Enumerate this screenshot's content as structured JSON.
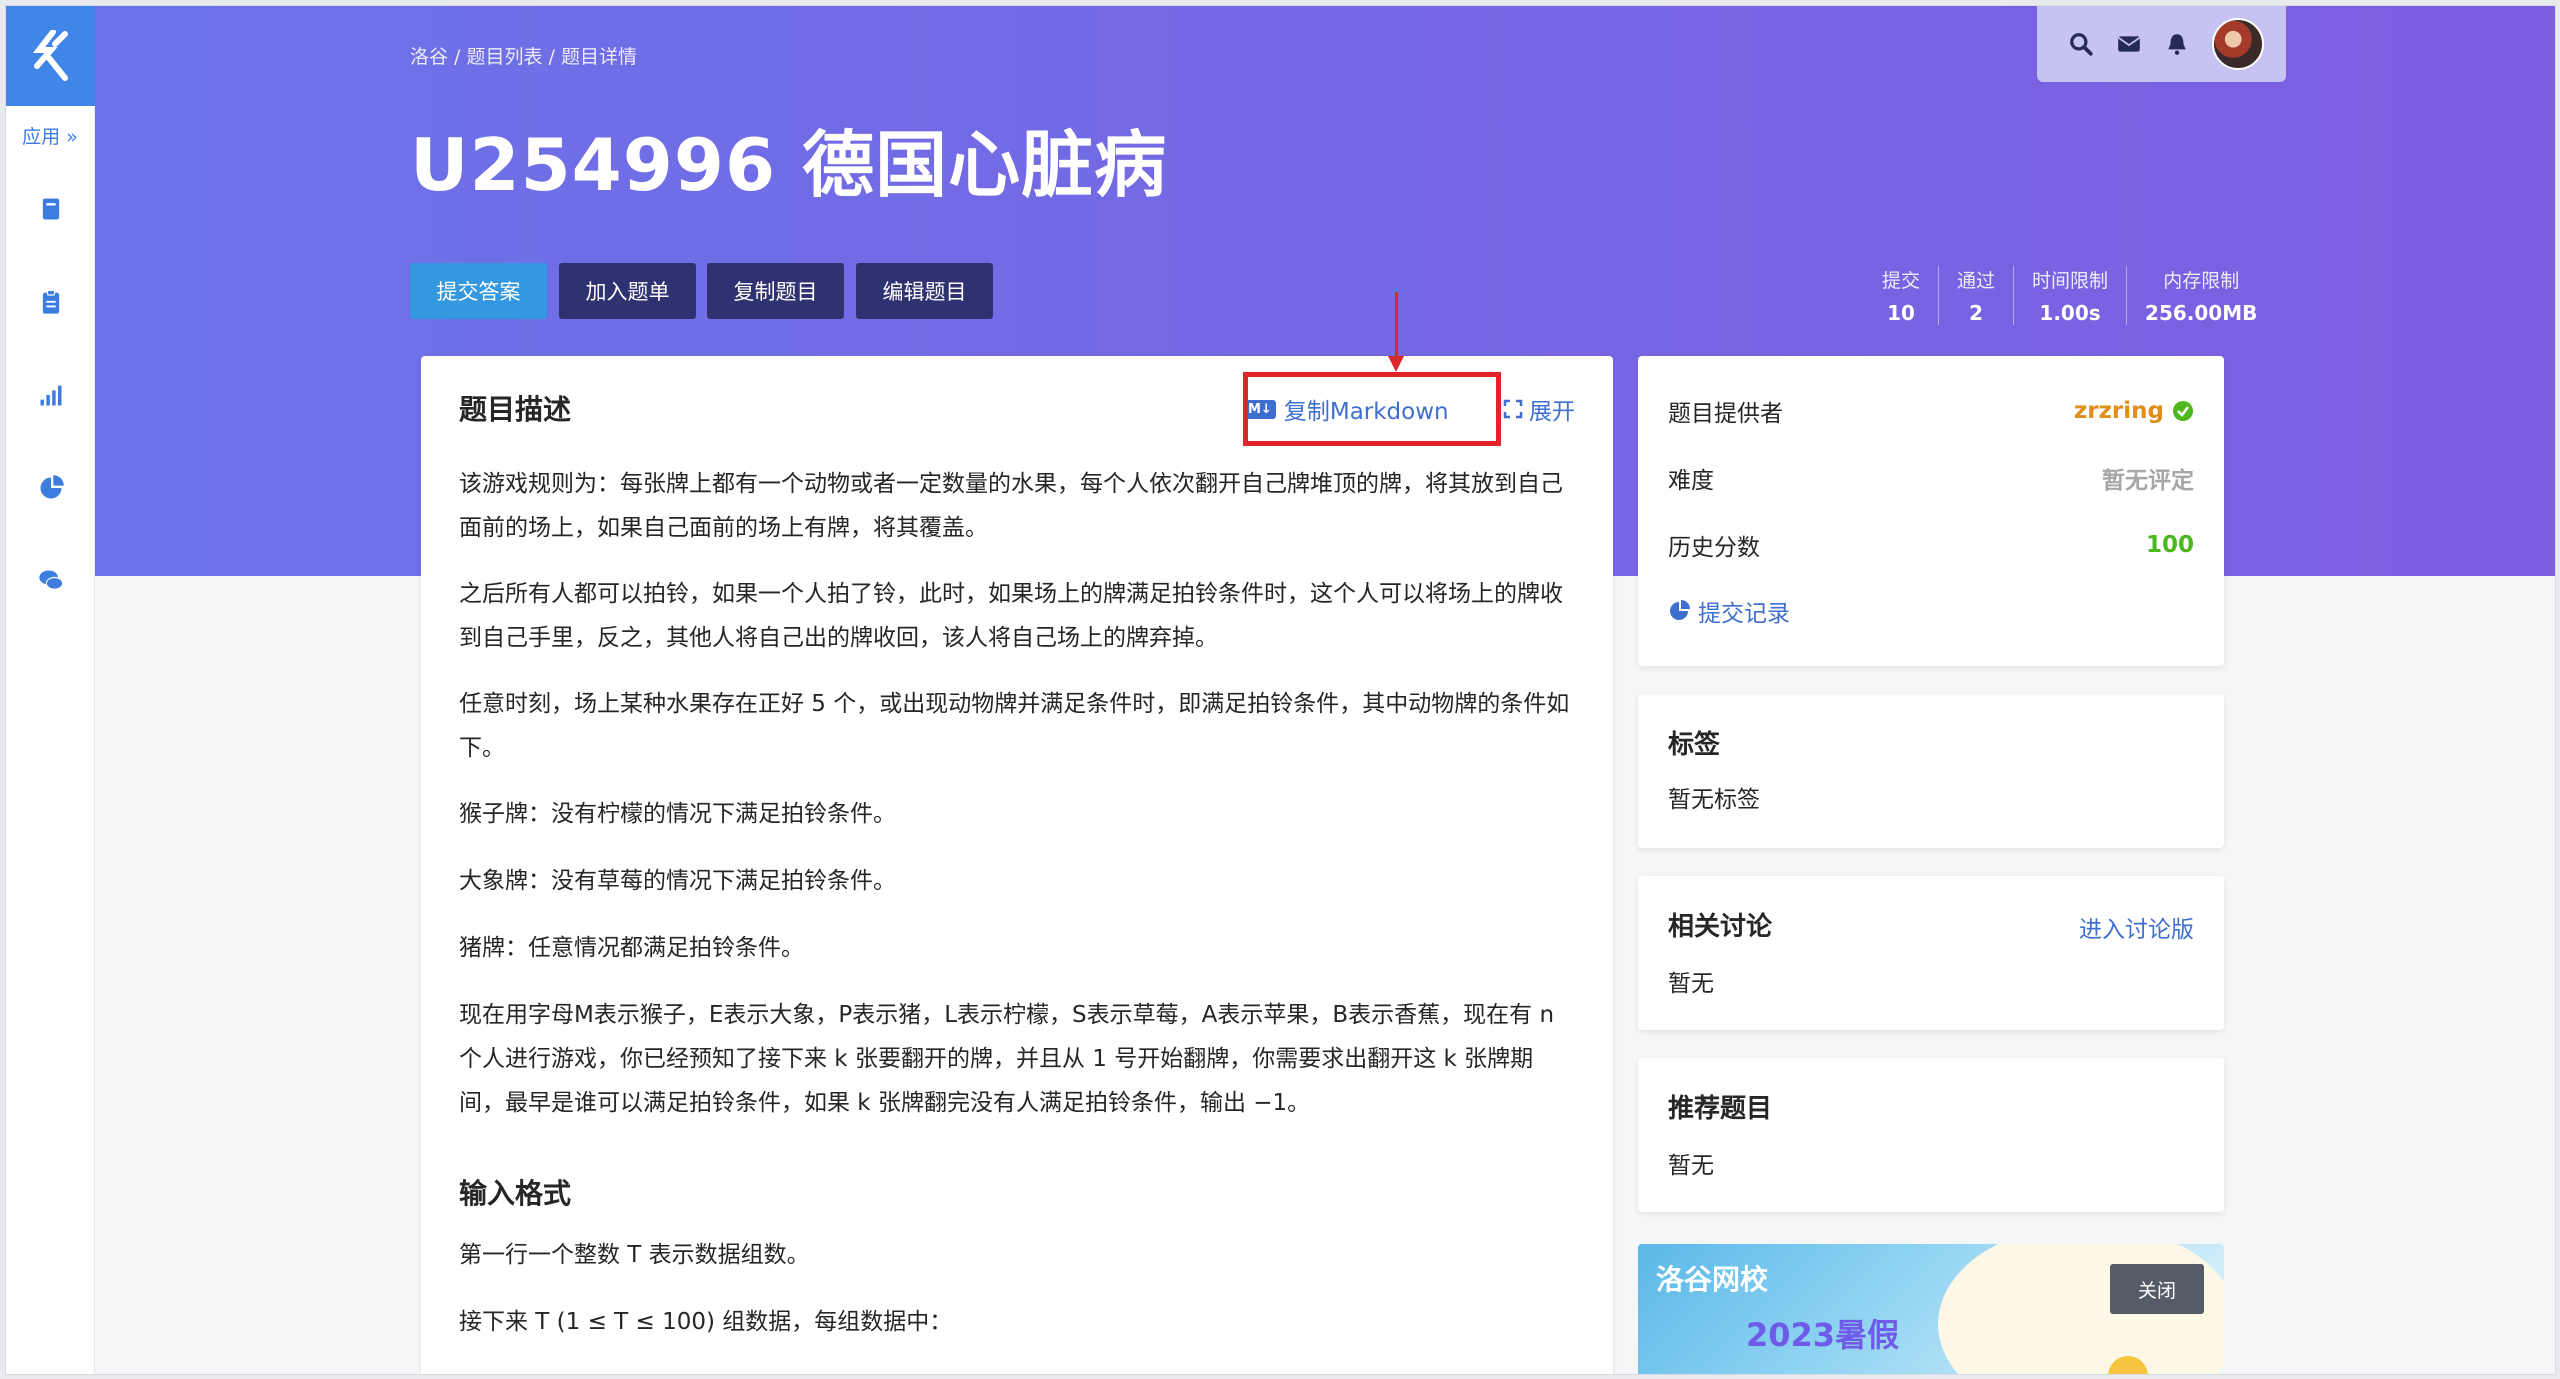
{
  "breadcrumb": [
    "洛谷",
    "题目列表",
    "题目详情"
  ],
  "breadcrumb_sep": " / ",
  "title": "U254996 德国心脏病",
  "sidebar": {
    "app_label": "应用 »",
    "icons": [
      "book-icon",
      "clipboard-icon",
      "chart-bar-icon",
      "pie-chart-icon",
      "comments-icon"
    ]
  },
  "topbar": {
    "icons": [
      "search-icon",
      "mail-icon",
      "bell-icon"
    ]
  },
  "actions": {
    "submit": "提交答案",
    "add_to_list": "加入题单",
    "copy_problem": "复制题目",
    "edit_problem": "编辑题目"
  },
  "stats": [
    {
      "label": "提交",
      "value": "10"
    },
    {
      "label": "通过",
      "value": "2"
    },
    {
      "label": "时间限制",
      "value": "1.00s"
    },
    {
      "label": "内存限制",
      "value": "256.00MB"
    }
  ],
  "problem": {
    "heading": "题目描述",
    "copy_markdown": "复制Markdown",
    "md_badge": "M↓",
    "expand": "展开",
    "paragraphs": [
      "该游戏规则为：每张牌上都有一个动物或者一定数量的水果，每个人依次翻开自己牌堆顶的牌，将其放到自己面前的场上，如果自己面前的场上有牌，将其覆盖。",
      "之后所有人都可以拍铃，如果一个人拍了铃，此时，如果场上的牌满足拍铃条件时，这个人可以将场上的牌收到自己手里，反之，其他人将自己出的牌收回，该人将自己场上的牌弃掉。",
      "任意时刻，场上某种水果存在正好 5 个，或出现动物牌并满足条件时，即满足拍铃条件，其中动物牌的条件如下。",
      "猴子牌：没有柠檬的情况下满足拍铃条件。",
      "大象牌：没有草莓的情况下满足拍铃条件。",
      "猪牌：任意情况都满足拍铃条件。",
      "现在用字母M表示猴子，E表示大象，P表示猪，L表示柠檬，S表示草莓，A表示苹果，B表示香蕉，现在有 n 个人进行游戏，你已经预知了接下来 k 张要翻开的牌，并且从 1 号开始翻牌，你需要求出翻开这 k 张牌期间，最早是谁可以满足拍铃条件，如果 k 张牌翻完没有人满足拍铃条件，输出 −1。"
    ],
    "input_heading": "输入格式",
    "input_paragraphs": [
      "第一行一个整数 T 表示数据组数。",
      "接下来 T (1 ≤ T ≤ 100) 组数据，每组数据中："
    ]
  },
  "info": {
    "provider_label": "题目提供者",
    "provider": "zrzring",
    "difficulty_label": "难度",
    "difficulty": "暂无评定",
    "score_label": "历史分数",
    "score": "100",
    "records_link": "提交记录"
  },
  "tags": {
    "title": "标签",
    "text": "暂无标签"
  },
  "discussion": {
    "title": "相关讨论",
    "link": "进入讨论版",
    "text": "暂无"
  },
  "recommend": {
    "title": "推荐题目",
    "text": "暂无"
  },
  "ad": {
    "brand": "洛谷网校",
    "year": "2023暑假",
    "close": "关闭"
  },
  "colors": {
    "accent": "#3e6fcf",
    "banner_start": "#6b73e8",
    "banner_end": "#7d5ee0",
    "highlight": "#e0252b"
  }
}
